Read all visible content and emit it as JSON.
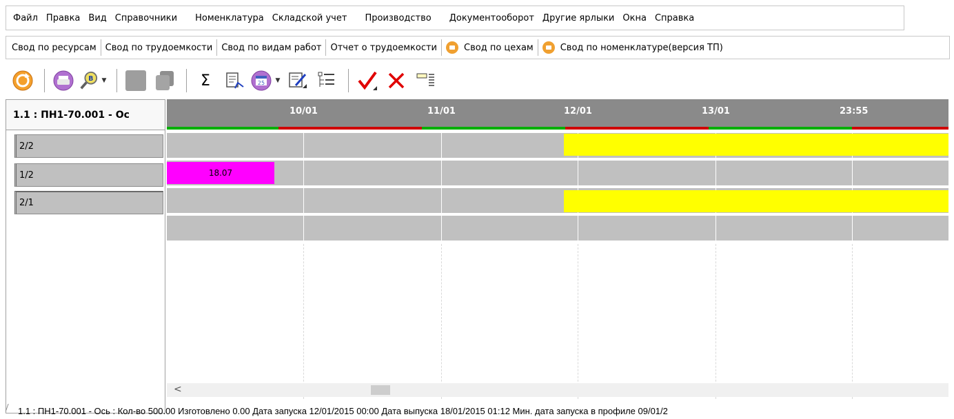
{
  "menu": [
    "Файл",
    "Правка",
    "Вид",
    "Справочники",
    "Номенклатура",
    "Складской учет",
    "Производство",
    "Документооборот",
    "Другие ярлыки",
    "Окна",
    "Справка"
  ],
  "tabs": [
    {
      "label": "Свод по ресурсам",
      "icon": null
    },
    {
      "label": "Свод по трудоемкости",
      "icon": null
    },
    {
      "label": "Свод по видам работ",
      "icon": null
    },
    {
      "label": "Отчет о трудоемкости",
      "icon": null
    },
    {
      "label": "Свод по цехам",
      "icon": "workshop-icon"
    },
    {
      "label": "Свод по номенклатуре(версия ТП)",
      "icon": "nomenclature-icon"
    }
  ],
  "toolbar": {
    "icons": [
      "refresh-icon",
      "print-icon",
      "search-b-icon",
      "disabled-square-icon",
      "disabled-copy-icon",
      "sigma-icon",
      "edit-doc-icon",
      "calendar-icon",
      "edit-form-icon",
      "tree-list-icon",
      "check-icon",
      "close-icon",
      "column-settings-icon"
    ],
    "sigma": "Σ",
    "calendar_day": "25"
  },
  "left_panel": {
    "header": "1.1 : ПН1-70.001 - Ос",
    "rows": [
      "2/2",
      "1/2",
      "2/1"
    ]
  },
  "gantt": {
    "dates": [
      "10/01",
      "11/01",
      "12/01",
      "13/01",
      "23:55"
    ],
    "bar_label": "18.07",
    "colors": {
      "header": "#8a8a8a",
      "row": "#c0c0c0",
      "bar_yellow": "#ffff00",
      "bar_magenta": "#ff00ff",
      "status_green": "#00b000",
      "status_red": "#d00000"
    }
  },
  "scroll_left": "<",
  "statusbar": "1.1 : ПН1-70.001 - Ось : Кол-во 500.00 Изготовлено 0.00 Дата запуска 12/01/2015 00:00 Дата выпуска 18/01/2015 01:12 Мин. дата запуска в профиле 09/01/2"
}
